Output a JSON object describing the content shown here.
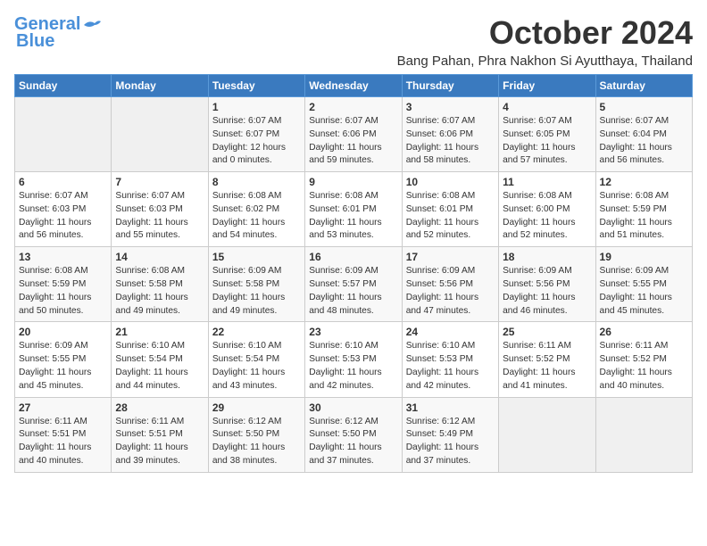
{
  "header": {
    "logo_line1": "General",
    "logo_line2": "Blue",
    "month": "October 2024",
    "location": "Bang Pahan, Phra Nakhon Si Ayutthaya, Thailand"
  },
  "days_of_week": [
    "Sunday",
    "Monday",
    "Tuesday",
    "Wednesday",
    "Thursday",
    "Friday",
    "Saturday"
  ],
  "weeks": [
    [
      {
        "day": "",
        "sunrise": "",
        "sunset": "",
        "daylight": ""
      },
      {
        "day": "",
        "sunrise": "",
        "sunset": "",
        "daylight": ""
      },
      {
        "day": "1",
        "sunrise": "Sunrise: 6:07 AM",
        "sunset": "Sunset: 6:07 PM",
        "daylight": "Daylight: 12 hours and 0 minutes."
      },
      {
        "day": "2",
        "sunrise": "Sunrise: 6:07 AM",
        "sunset": "Sunset: 6:06 PM",
        "daylight": "Daylight: 11 hours and 59 minutes."
      },
      {
        "day": "3",
        "sunrise": "Sunrise: 6:07 AM",
        "sunset": "Sunset: 6:06 PM",
        "daylight": "Daylight: 11 hours and 58 minutes."
      },
      {
        "day": "4",
        "sunrise": "Sunrise: 6:07 AM",
        "sunset": "Sunset: 6:05 PM",
        "daylight": "Daylight: 11 hours and 57 minutes."
      },
      {
        "day": "5",
        "sunrise": "Sunrise: 6:07 AM",
        "sunset": "Sunset: 6:04 PM",
        "daylight": "Daylight: 11 hours and 56 minutes."
      }
    ],
    [
      {
        "day": "6",
        "sunrise": "Sunrise: 6:07 AM",
        "sunset": "Sunset: 6:03 PM",
        "daylight": "Daylight: 11 hours and 56 minutes."
      },
      {
        "day": "7",
        "sunrise": "Sunrise: 6:07 AM",
        "sunset": "Sunset: 6:03 PM",
        "daylight": "Daylight: 11 hours and 55 minutes."
      },
      {
        "day": "8",
        "sunrise": "Sunrise: 6:08 AM",
        "sunset": "Sunset: 6:02 PM",
        "daylight": "Daylight: 11 hours and 54 minutes."
      },
      {
        "day": "9",
        "sunrise": "Sunrise: 6:08 AM",
        "sunset": "Sunset: 6:01 PM",
        "daylight": "Daylight: 11 hours and 53 minutes."
      },
      {
        "day": "10",
        "sunrise": "Sunrise: 6:08 AM",
        "sunset": "Sunset: 6:01 PM",
        "daylight": "Daylight: 11 hours and 52 minutes."
      },
      {
        "day": "11",
        "sunrise": "Sunrise: 6:08 AM",
        "sunset": "Sunset: 6:00 PM",
        "daylight": "Daylight: 11 hours and 52 minutes."
      },
      {
        "day": "12",
        "sunrise": "Sunrise: 6:08 AM",
        "sunset": "Sunset: 5:59 PM",
        "daylight": "Daylight: 11 hours and 51 minutes."
      }
    ],
    [
      {
        "day": "13",
        "sunrise": "Sunrise: 6:08 AM",
        "sunset": "Sunset: 5:59 PM",
        "daylight": "Daylight: 11 hours and 50 minutes."
      },
      {
        "day": "14",
        "sunrise": "Sunrise: 6:08 AM",
        "sunset": "Sunset: 5:58 PM",
        "daylight": "Daylight: 11 hours and 49 minutes."
      },
      {
        "day": "15",
        "sunrise": "Sunrise: 6:09 AM",
        "sunset": "Sunset: 5:58 PM",
        "daylight": "Daylight: 11 hours and 49 minutes."
      },
      {
        "day": "16",
        "sunrise": "Sunrise: 6:09 AM",
        "sunset": "Sunset: 5:57 PM",
        "daylight": "Daylight: 11 hours and 48 minutes."
      },
      {
        "day": "17",
        "sunrise": "Sunrise: 6:09 AM",
        "sunset": "Sunset: 5:56 PM",
        "daylight": "Daylight: 11 hours and 47 minutes."
      },
      {
        "day": "18",
        "sunrise": "Sunrise: 6:09 AM",
        "sunset": "Sunset: 5:56 PM",
        "daylight": "Daylight: 11 hours and 46 minutes."
      },
      {
        "day": "19",
        "sunrise": "Sunrise: 6:09 AM",
        "sunset": "Sunset: 5:55 PM",
        "daylight": "Daylight: 11 hours and 45 minutes."
      }
    ],
    [
      {
        "day": "20",
        "sunrise": "Sunrise: 6:09 AM",
        "sunset": "Sunset: 5:55 PM",
        "daylight": "Daylight: 11 hours and 45 minutes."
      },
      {
        "day": "21",
        "sunrise": "Sunrise: 6:10 AM",
        "sunset": "Sunset: 5:54 PM",
        "daylight": "Daylight: 11 hours and 44 minutes."
      },
      {
        "day": "22",
        "sunrise": "Sunrise: 6:10 AM",
        "sunset": "Sunset: 5:54 PM",
        "daylight": "Daylight: 11 hours and 43 minutes."
      },
      {
        "day": "23",
        "sunrise": "Sunrise: 6:10 AM",
        "sunset": "Sunset: 5:53 PM",
        "daylight": "Daylight: 11 hours and 42 minutes."
      },
      {
        "day": "24",
        "sunrise": "Sunrise: 6:10 AM",
        "sunset": "Sunset: 5:53 PM",
        "daylight": "Daylight: 11 hours and 42 minutes."
      },
      {
        "day": "25",
        "sunrise": "Sunrise: 6:11 AM",
        "sunset": "Sunset: 5:52 PM",
        "daylight": "Daylight: 11 hours and 41 minutes."
      },
      {
        "day": "26",
        "sunrise": "Sunrise: 6:11 AM",
        "sunset": "Sunset: 5:52 PM",
        "daylight": "Daylight: 11 hours and 40 minutes."
      }
    ],
    [
      {
        "day": "27",
        "sunrise": "Sunrise: 6:11 AM",
        "sunset": "Sunset: 5:51 PM",
        "daylight": "Daylight: 11 hours and 40 minutes."
      },
      {
        "day": "28",
        "sunrise": "Sunrise: 6:11 AM",
        "sunset": "Sunset: 5:51 PM",
        "daylight": "Daylight: 11 hours and 39 minutes."
      },
      {
        "day": "29",
        "sunrise": "Sunrise: 6:12 AM",
        "sunset": "Sunset: 5:50 PM",
        "daylight": "Daylight: 11 hours and 38 minutes."
      },
      {
        "day": "30",
        "sunrise": "Sunrise: 6:12 AM",
        "sunset": "Sunset: 5:50 PM",
        "daylight": "Daylight: 11 hours and 37 minutes."
      },
      {
        "day": "31",
        "sunrise": "Sunrise: 6:12 AM",
        "sunset": "Sunset: 5:49 PM",
        "daylight": "Daylight: 11 hours and 37 minutes."
      },
      {
        "day": "",
        "sunrise": "",
        "sunset": "",
        "daylight": ""
      },
      {
        "day": "",
        "sunrise": "",
        "sunset": "",
        "daylight": ""
      }
    ]
  ]
}
